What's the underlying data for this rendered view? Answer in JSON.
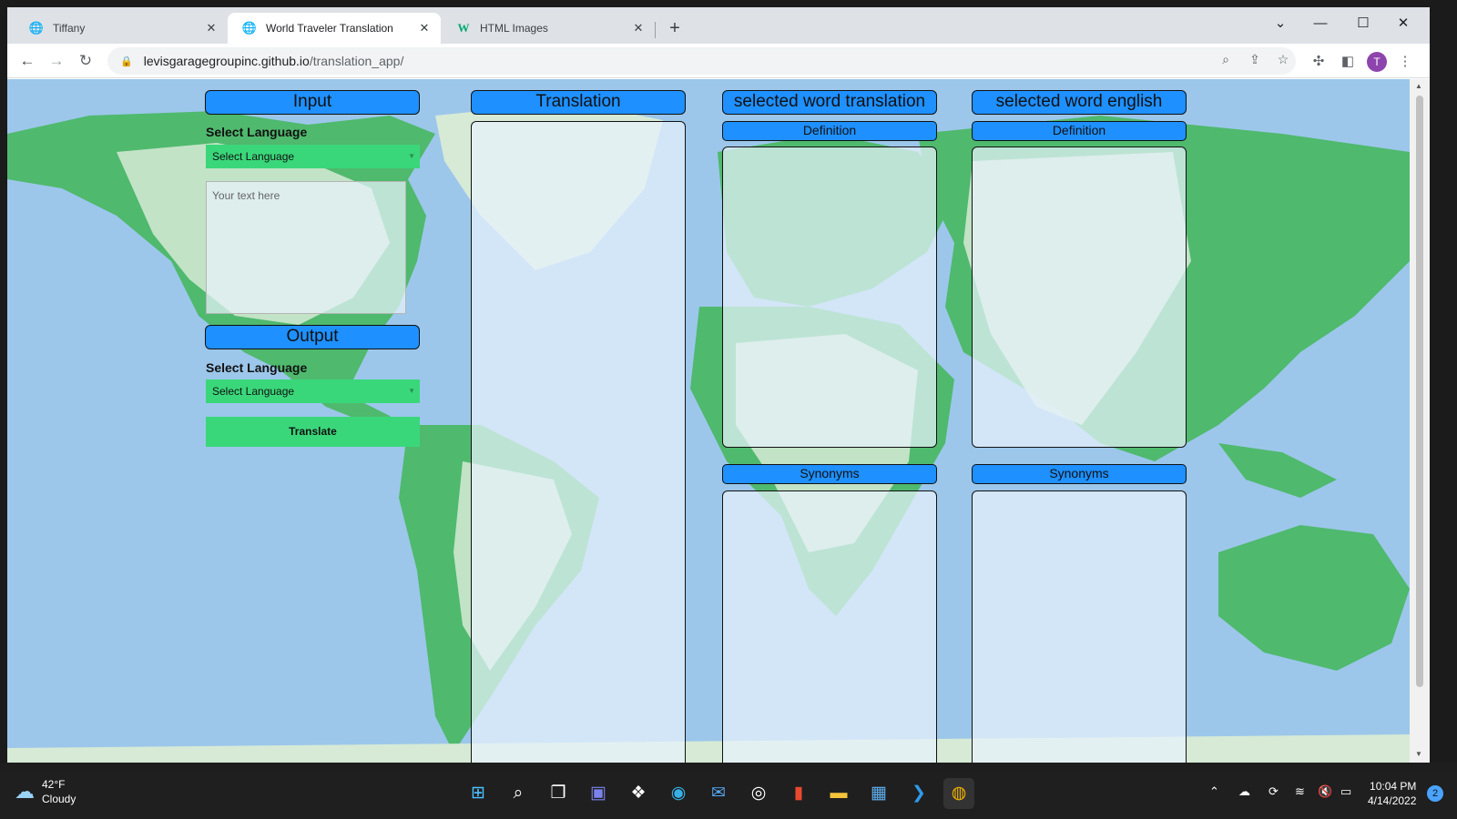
{
  "browser": {
    "tabs": [
      {
        "title": "Tiffany",
        "icon": "globe-icon",
        "active": false
      },
      {
        "title": "World Traveler Translation",
        "icon": "globe-icon",
        "active": true
      },
      {
        "title": "HTML Images",
        "icon": "w3schools-icon",
        "active": false
      }
    ],
    "close_glyph": "✕",
    "newtab_glyph": "+",
    "url_host": "levisgaragegroupinc.github.io",
    "url_path": "/translation_app/",
    "profile_initial": "T"
  },
  "page": {
    "input": {
      "header": "Input",
      "select_label": "Select Language",
      "select_value": "Select Language",
      "textarea_placeholder": "Your text here"
    },
    "output": {
      "header": "Output",
      "select_label": "Select Language",
      "select_value": "Select Language",
      "translate_button": "Translate"
    },
    "translation": {
      "header": "Translation"
    },
    "selected_translation": {
      "header": "selected word translation",
      "definition_label": "Definition",
      "synonyms_label": "Synonyms"
    },
    "selected_english": {
      "header": "selected word english",
      "definition_label": "Definition",
      "synonyms_label": "Synonyms"
    }
  },
  "taskbar": {
    "weather_temp": "42°F",
    "weather_desc": "Cloudy",
    "time": "10:04 PM",
    "date": "4/14/2022",
    "notification_count": "2"
  },
  "colors": {
    "header_blue": "#1e90ff",
    "select_green": "#3ad77a",
    "ocean": "#9cc7ea",
    "land": "#4fb96e"
  }
}
